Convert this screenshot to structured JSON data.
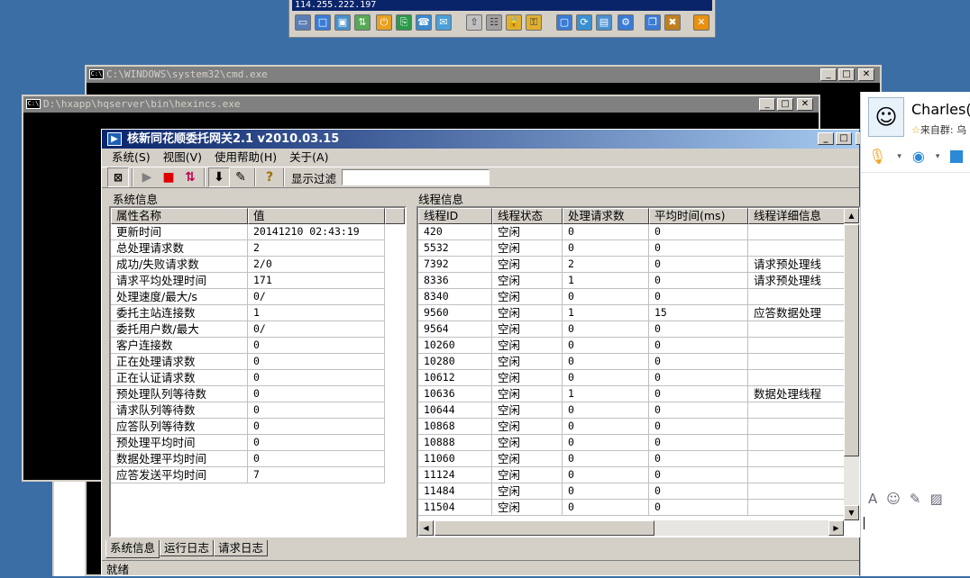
{
  "remote_toolbar": {
    "ip": "114.255.222.197"
  },
  "cmd_window": {
    "title": "C:\\WINDOWS\\system32\\cmd.exe"
  },
  "hq_window": {
    "title": "D:\\hxapp\\hqserver\\bin\\hexincs.exe"
  },
  "main_window": {
    "title": "核新同花顺委托网关2.1 v2010.03.15",
    "menu": [
      "系统(S)",
      "视图(V)",
      "使用帮助(H)",
      "关于(A)"
    ],
    "filter_label": "显示过滤",
    "filter_value": "",
    "sys_section": "系统信息",
    "thread_section": "线程信息",
    "sys_headers": [
      "属性名称",
      "值"
    ],
    "sys_rows": [
      [
        "更新时间",
        "20141210 02:43:19"
      ],
      [
        "总处理请求数",
        "2"
      ],
      [
        "成功/失败请求数",
        "2/0"
      ],
      [
        "请求平均处理时间",
        "171"
      ],
      [
        "处理速度/最大/s",
        "0/"
      ],
      [
        "委托主站连接数",
        "1"
      ],
      [
        "委托用户数/最大",
        "0/"
      ],
      [
        "客户连接数",
        "0"
      ],
      [
        "正在处理请求数",
        "0"
      ],
      [
        "正在认证请求数",
        "0"
      ],
      [
        "预处理队列等待数",
        "0"
      ],
      [
        "请求队列等待数",
        "0"
      ],
      [
        "应答队列等待数",
        "0"
      ],
      [
        "预处理平均时间",
        "0"
      ],
      [
        "数据处理平均时间",
        "0"
      ],
      [
        "应答发送平均时间",
        "7"
      ]
    ],
    "thread_headers": [
      "线程ID",
      "线程状态",
      "处理请求数",
      "平均时间(ms)",
      "线程详细信息"
    ],
    "thread_rows": [
      [
        "420",
        "空闲",
        "0",
        "0",
        ""
      ],
      [
        "5532",
        "空闲",
        "0",
        "0",
        ""
      ],
      [
        "7392",
        "空闲",
        "2",
        "0",
        "请求预处理线"
      ],
      [
        "8336",
        "空闲",
        "1",
        "0",
        "请求预处理线"
      ],
      [
        "8340",
        "空闲",
        "0",
        "0",
        ""
      ],
      [
        "9560",
        "空闲",
        "1",
        "15",
        "应答数据处理"
      ],
      [
        "9564",
        "空闲",
        "0",
        "0",
        ""
      ],
      [
        "10260",
        "空闲",
        "0",
        "0",
        ""
      ],
      [
        "10280",
        "空闲",
        "0",
        "0",
        ""
      ],
      [
        "10612",
        "空闲",
        "0",
        "0",
        ""
      ],
      [
        "10636",
        "空闲",
        "1",
        "0",
        "数据处理线程"
      ],
      [
        "10644",
        "空闲",
        "0",
        "0",
        ""
      ],
      [
        "10868",
        "空闲",
        "0",
        "0",
        ""
      ],
      [
        "10888",
        "空闲",
        "0",
        "0",
        ""
      ],
      [
        "11060",
        "空闲",
        "0",
        "0",
        ""
      ],
      [
        "11124",
        "空闲",
        "0",
        "0",
        ""
      ],
      [
        "11484",
        "空闲",
        "0",
        "0",
        ""
      ],
      [
        "11504",
        "空闲",
        "0",
        "0",
        ""
      ]
    ],
    "tabs": [
      "系统信息",
      "运行日志",
      "请求日志"
    ],
    "status": "就绪"
  },
  "chat_panel": {
    "name": "Charles(",
    "subtitle": "来自群: 乌"
  }
}
